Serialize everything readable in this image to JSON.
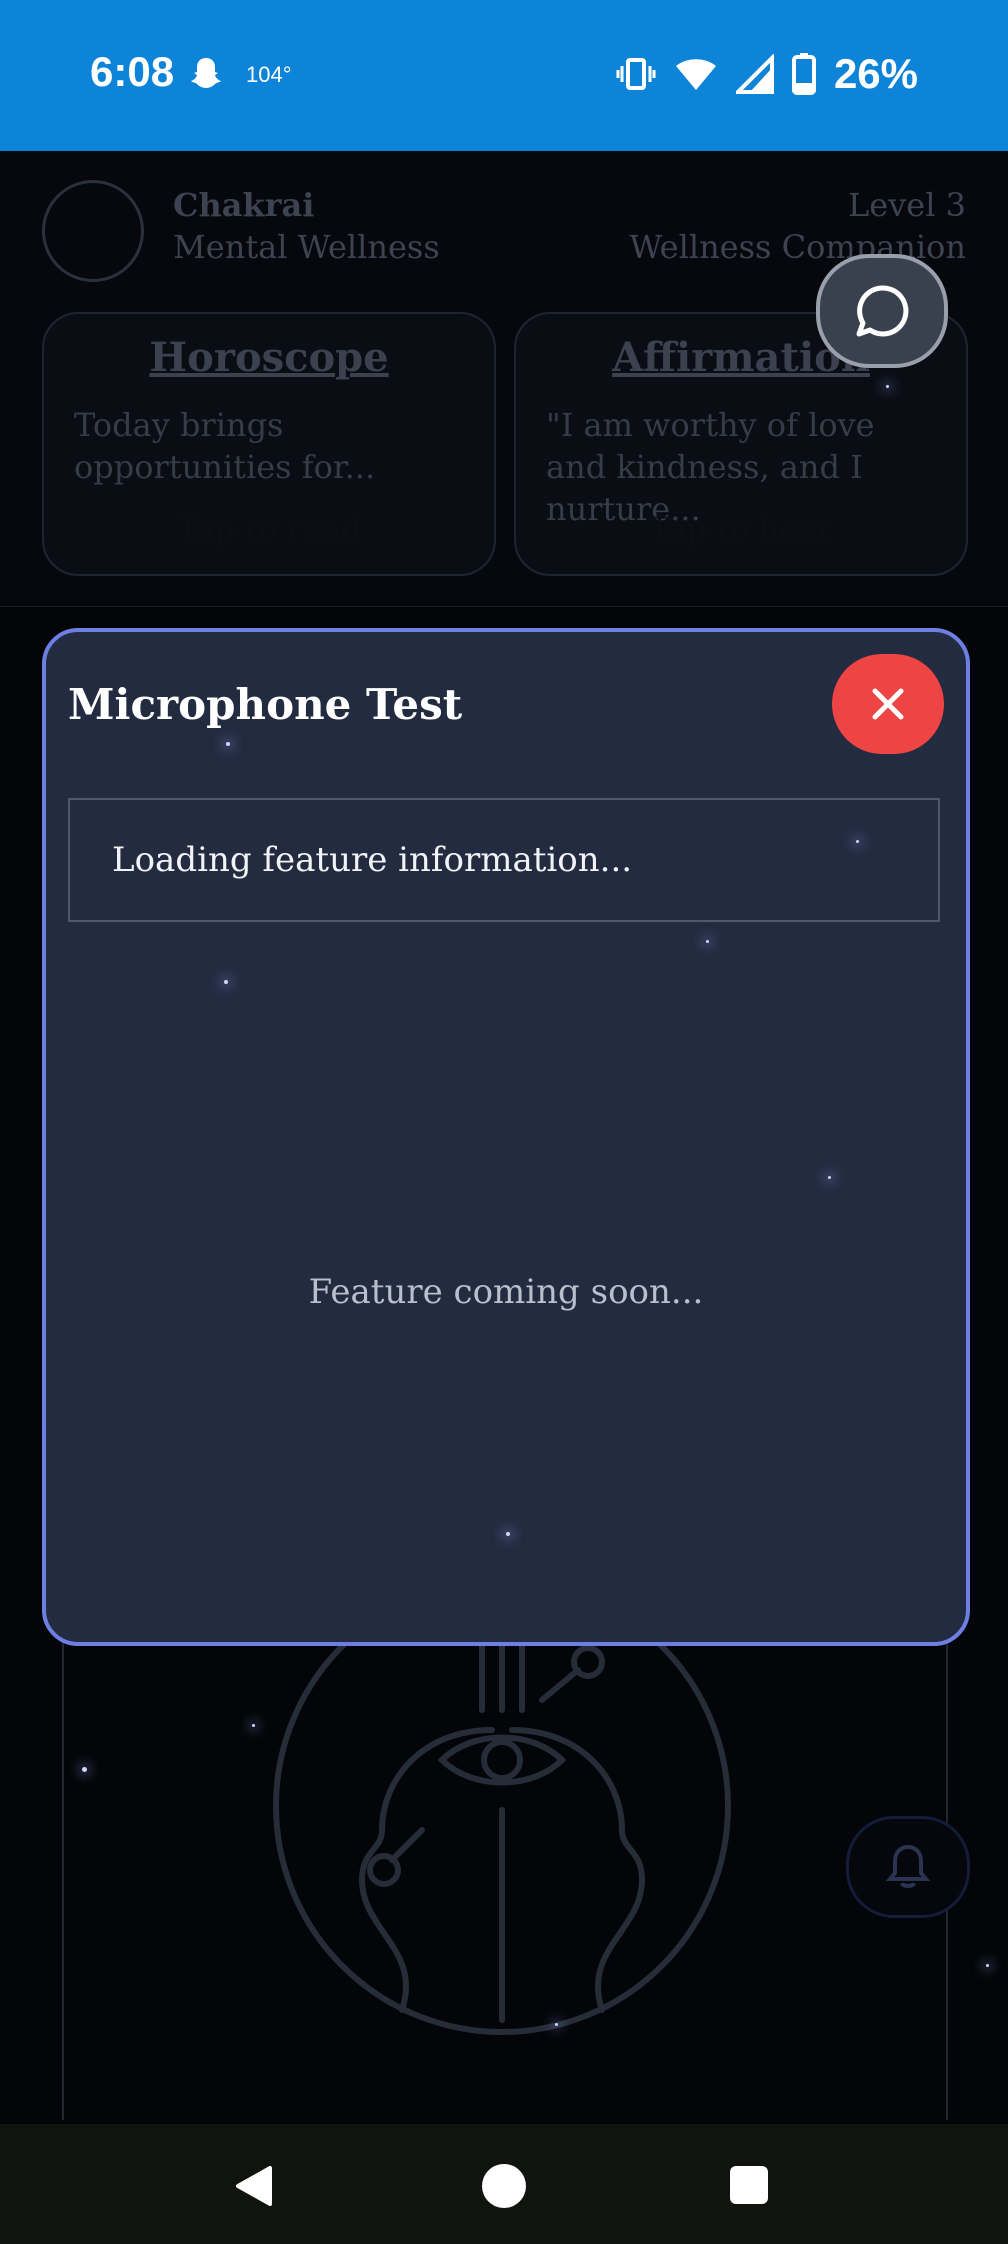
{
  "status_bar": {
    "time": "6:08",
    "temperature": "104°",
    "battery": "26%"
  },
  "header": {
    "app_name": "Chakrai",
    "app_subtitle": "Mental Wellness",
    "level": "Level 3",
    "level_subtitle": "Wellness Companion"
  },
  "cards": [
    {
      "title": "Horoscope",
      "body": "Today brings opportunities for...",
      "action": "Tap to read"
    },
    {
      "title": "Affirmation",
      "body": "\"I am worthy of love and kindness, and I nurture...",
      "action": "Tap to hear"
    }
  ],
  "modal": {
    "title": "Microphone Test",
    "info": "Loading feature information...",
    "message": "Feature coming soon..."
  },
  "colors": {
    "status_bar": "#0e84d8",
    "modal_bg": "#222b3f",
    "modal_border": "#6d7fe2",
    "close_button": "#ef4444"
  },
  "icons": [
    "snapchat-icon",
    "vibrate-icon",
    "wifi-icon",
    "signal-icon",
    "battery-icon",
    "chat-icon",
    "close-icon",
    "bell-icon",
    "back-icon",
    "home-icon",
    "recents-icon"
  ]
}
